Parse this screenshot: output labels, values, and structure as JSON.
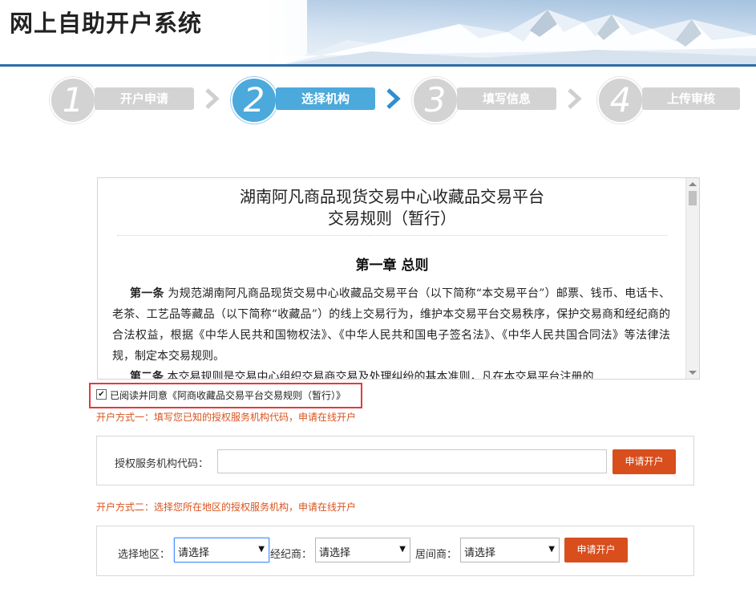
{
  "header": {
    "title": "网上自助开户系统"
  },
  "steps": [
    {
      "number": "1",
      "label": "开户申请",
      "active": false
    },
    {
      "number": "2",
      "label": "选择机构",
      "active": true
    },
    {
      "number": "3",
      "label": "填写信息",
      "active": false
    },
    {
      "number": "4",
      "label": "上传审核",
      "active": false
    }
  ],
  "rules": {
    "title_line1": "湖南阿凡商品现货交易中心收藏品交易平台",
    "title_line2": "交易规则（暂行）",
    "chapter": "第一章 总则",
    "article1_head": "第一条",
    "article1_text": "  为规范湖南阿凡商品现货交易中心收藏品交易平台（以下简称“本交易平台”）邮票、钱币、电话卡、老茶、工艺品等藏品（以下简称“收藏品”）的线上交易行为，维护本交易平台交易秩序，保护交易商和经纪商的合法权益，根据《中华人民共和国物权法》、《中华人民共和国电子签名法》、《中华人民共国合同法》等法律法规，制定本交易规则。",
    "article2_head": "第二条",
    "article2_text": "  本交易规则是交易中心组织交易商交易及处理纠纷的基本准则，凡在本交易平台注册的"
  },
  "agree": {
    "checked": true,
    "text": "已阅读并同意《阿商收藏品交易平台交易规则（暂行）》"
  },
  "method1": {
    "hint": "开户方式一：填写您已知的授权服务机构代码，申请在线开户",
    "label": "授权服务机构代码：",
    "input_value": "",
    "button": "申请开户"
  },
  "method2": {
    "hint": "开户方式二：选择您所在地区的授权服务机构，申请在线开户",
    "region_label": "选择地区：",
    "region_value": "请选择",
    "broker_label": "经纪商：",
    "broker_value": "请选择",
    "intermediary_label": "居间商：",
    "intermediary_value": "请选择",
    "button": "申请开户"
  },
  "colors": {
    "accent": "#4ba9dc",
    "button": "#d84e1d",
    "hint": "#d9531e",
    "highlight_border": "#e23b3b",
    "header_line": "#2d6ea8"
  }
}
